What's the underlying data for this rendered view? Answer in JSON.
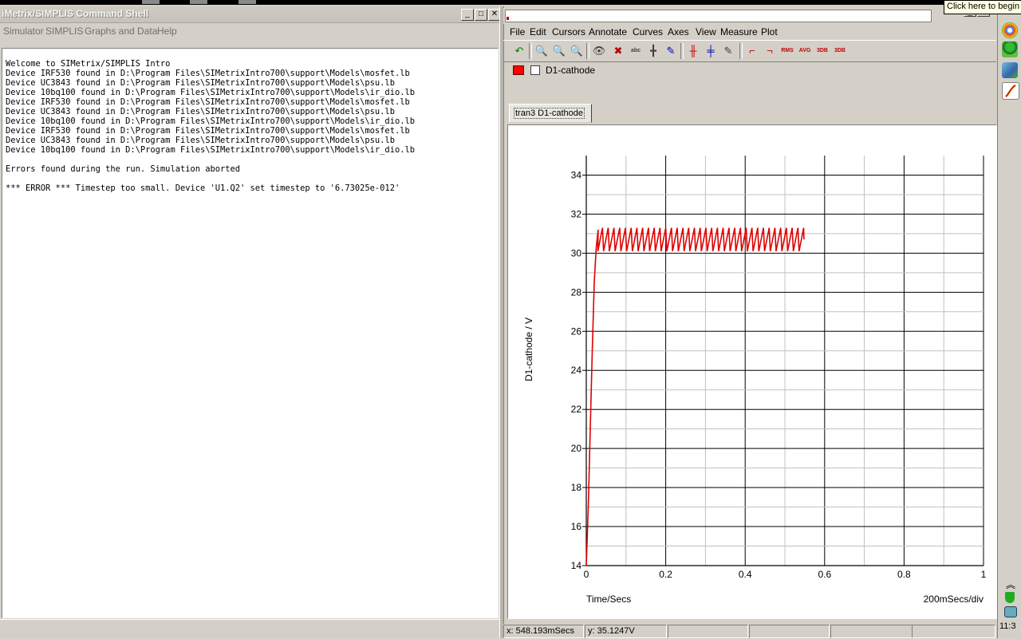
{
  "left_window": {
    "title": "iMetrix/SIMPLIS Command Shell",
    "menu": [
      "Simulator",
      "SIMPLIS",
      "Graphs and Data",
      "Help"
    ],
    "console_lines": [
      "Welcome to SIMetrix/SIMPLIS Intro",
      "Device IRF530 found in D:\\Program Files\\SIMetrixIntro700\\support\\Models\\mosfet.lb",
      "Device UC3843 found in D:\\Program Files\\SIMetrixIntro700\\support\\Models\\psu.lb",
      "Device 10bq100 found in D:\\Program Files\\SIMetrixIntro700\\support\\Models\\ir_dio.lb",
      "Device IRF530 found in D:\\Program Files\\SIMetrixIntro700\\support\\Models\\mosfet.lb",
      "Device UC3843 found in D:\\Program Files\\SIMetrixIntro700\\support\\Models\\psu.lb",
      "Device 10bq100 found in D:\\Program Files\\SIMetrixIntro700\\support\\Models\\ir_dio.lb",
      "Device IRF530 found in D:\\Program Files\\SIMetrixIntro700\\support\\Models\\mosfet.lb",
      "Device UC3843 found in D:\\Program Files\\SIMetrixIntro700\\support\\Models\\psu.lb",
      "Device 10bq100 found in D:\\Program Files\\SIMetrixIntro700\\support\\Models\\ir_dio.lb",
      "",
      "Errors found during the run. Simulation aborted",
      "",
      "*** ERROR *** Timestep too small. Device 'U1.Q2' set timestep to '6.73025e-012'"
    ]
  },
  "right_window": {
    "menu": [
      "File",
      "Edit",
      "Cursors",
      "Annotate",
      "Curves",
      "Axes",
      "View",
      "Measure",
      "Plot"
    ],
    "toolbar": [
      {
        "icon": "undo-icon",
        "glyph": "↶",
        "color": "#008000"
      },
      {
        "icon": "zoom-fit-icon",
        "glyph": "🔍",
        "color": "#404040"
      },
      {
        "icon": "zoom-in-icon",
        "glyph": "🔍",
        "color": "#404040"
      },
      {
        "icon": "zoom-out-icon",
        "glyph": "🔍",
        "color": "#404040"
      },
      {
        "icon": "view-icon",
        "glyph": "👁",
        "color": "#404040"
      },
      {
        "icon": "delete-curve-icon",
        "glyph": "✖",
        "color": "#c00000"
      },
      {
        "icon": "label-icon",
        "glyph": "abc",
        "color": "#404040"
      },
      {
        "icon": "add-axis-icon",
        "glyph": "╋",
        "color": "#404040"
      },
      {
        "icon": "curve-edit-icon",
        "glyph": "✎",
        "color": "#0000c0"
      },
      {
        "icon": "cursor-vertical-icon",
        "glyph": "╫",
        "color": "#c00000"
      },
      {
        "icon": "cursor-horizontal-icon",
        "glyph": "╪",
        "color": "#0000c0"
      },
      {
        "icon": "measure-icon",
        "glyph": "✎",
        "color": "#404040"
      },
      {
        "icon": "rise-edge-icon",
        "glyph": "⌐",
        "color": "#c00000"
      },
      {
        "icon": "fall-edge-icon",
        "glyph": "¬",
        "color": "#c00000"
      },
      {
        "icon": "rms-icon",
        "glyph": "RMS",
        "color": "#c00000"
      },
      {
        "icon": "avg-icon",
        "glyph": "AVG",
        "color": "#c00000"
      },
      {
        "icon": "3db-icon",
        "glyph": "3DB",
        "color": "#c00000"
      },
      {
        "icon": "3db-high-icon",
        "glyph": "3DB",
        "color": "#c00000"
      }
    ],
    "legend_label": "D1-cathode",
    "legend_color": "#ff0000",
    "tab_label": "tran3 D1-cathode",
    "status_x": "x: 548.193mSecs",
    "status_y": "y: 35.1247V"
  },
  "tooltip": "Click here to begin",
  "clock": "11:3",
  "chart_data": {
    "type": "line",
    "ylabel": "D1-cathode / V",
    "xlabel": "Time/Secs",
    "x_scale_label": "200mSecs/div",
    "xlim": [
      0,
      1
    ],
    "ylim": [
      14,
      35
    ],
    "x_ticks": [
      0,
      0.2,
      0.4,
      0.6,
      0.8,
      1
    ],
    "x_tick_labels": [
      "0",
      "0.2",
      "0.4",
      "0.6",
      "0.8",
      "1"
    ],
    "y_ticks": [
      14,
      16,
      18,
      20,
      22,
      24,
      26,
      28,
      30,
      32,
      34
    ],
    "y_tick_labels": [
      "14",
      "16",
      "18",
      "20",
      "22",
      "24",
      "26",
      "28",
      "30",
      "32",
      "34"
    ],
    "grid": true,
    "series": [
      {
        "name": "D1-cathode",
        "color": "#e00000",
        "x": [
          0,
          0.005,
          0.01,
          0.015,
          0.02,
          0.025,
          0.03
        ],
        "y": [
          14,
          17,
          21,
          25,
          28.5,
          30.3,
          31.2
        ],
        "ripple": {
          "x_start": 0.027,
          "x_end": 0.548,
          "cycles": 36,
          "low": 30.1,
          "high": 31.3
        }
      }
    ]
  }
}
